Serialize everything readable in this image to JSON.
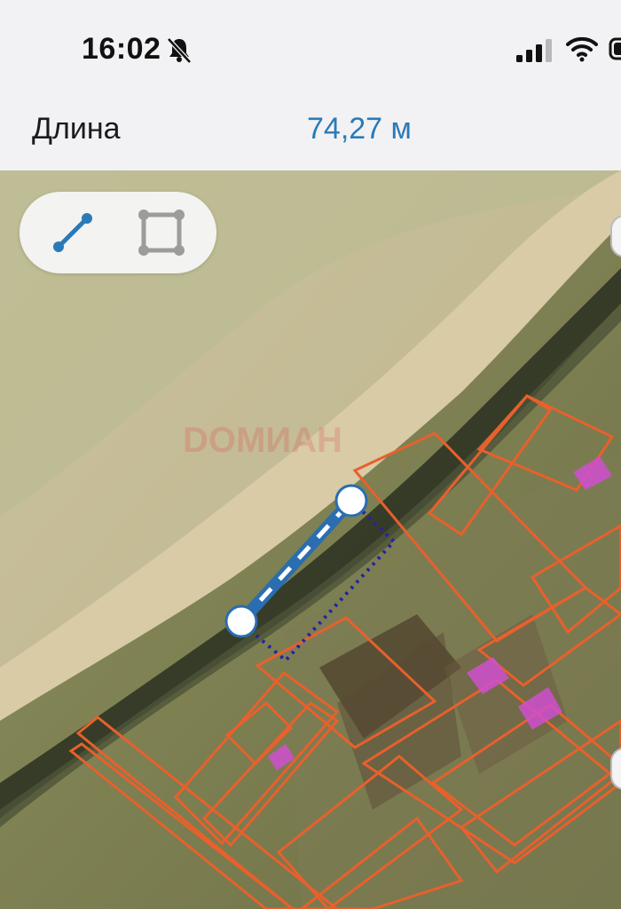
{
  "status": {
    "time": "16:02"
  },
  "measure": {
    "label": "Длина",
    "value": "74,27 м"
  },
  "tools": [
    {
      "name": "line-tool",
      "active": true
    },
    {
      "name": "polygon-tool",
      "active": false
    }
  ],
  "watermark": {
    "text": "DOMИАН"
  },
  "colors": {
    "accent": "#2a7ab8",
    "parcel": "#e8602c",
    "building": "#d04fd0",
    "measure_line": "#2a6db0",
    "dotted": "#2222aa"
  }
}
